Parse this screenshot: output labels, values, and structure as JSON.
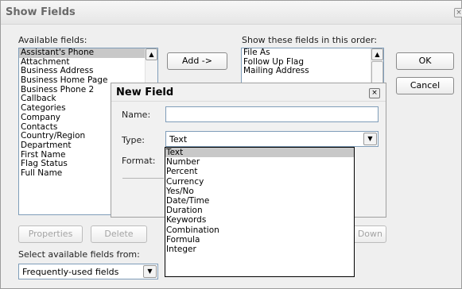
{
  "show_fields": {
    "title": "Show Fields",
    "close_glyph": "×",
    "available_label": "Available fields:",
    "available_items": [
      "Assistant's Phone",
      "Attachment",
      "Business Address",
      "Business Home Page",
      "Business Phone 2",
      "Callback",
      "Categories",
      "Company",
      "Contacts",
      "Country/Region",
      "Department",
      "First Name",
      "Flag Status",
      "Full Name"
    ],
    "available_selected": "Assistant's Phone",
    "show_label": "Show these fields in this order:",
    "shown_items": [
      "File As",
      "Follow Up Flag",
      "Mailing Address"
    ],
    "add_label": "Add ->",
    "ok_label": "OK",
    "cancel_label": "Cancel",
    "properties_label": "Properties",
    "delete_label": "Delete",
    "move_down_label": "Down",
    "select_from_label": "Select available fields from:",
    "select_from_value": "Frequently-used fields"
  },
  "new_field": {
    "title": "New Field",
    "close_glyph": "×",
    "name_label": "Name:",
    "name_value": "",
    "type_label": "Type:",
    "type_value": "Text",
    "format_label": "Format:",
    "type_options": [
      "Text",
      "Number",
      "Percent",
      "Currency",
      "Yes/No",
      "Date/Time",
      "Duration",
      "Keywords",
      "Combination",
      "Formula",
      "Integer"
    ],
    "type_selected": "Text"
  },
  "icons": {
    "scroll_up": "▲",
    "scroll_down": "▼",
    "dropdown": "▼",
    "grip": "≡"
  }
}
